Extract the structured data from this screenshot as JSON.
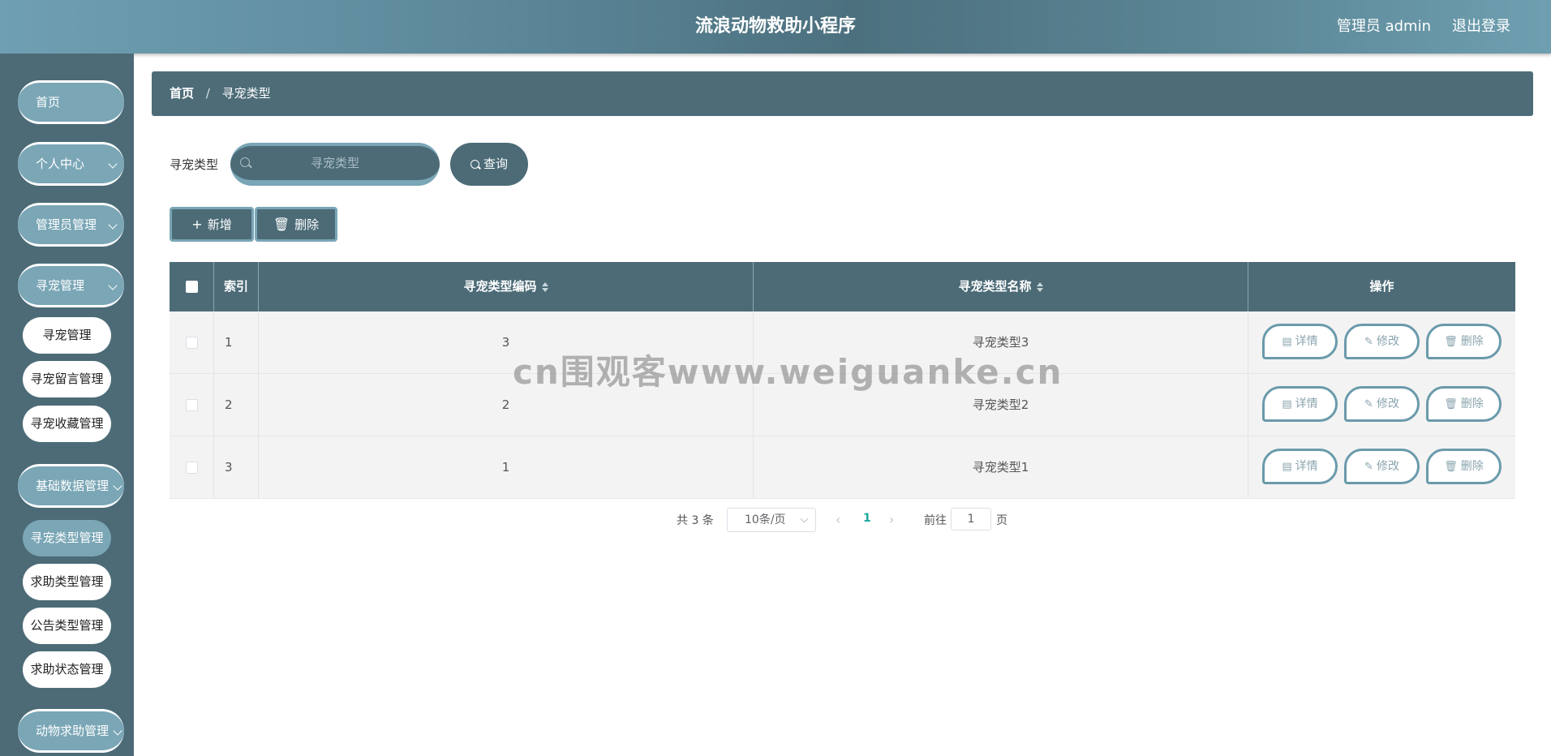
{
  "header": {
    "title": "流浪动物救助小程序",
    "user": "管理员 admin",
    "logout": "退出登录"
  },
  "sidebar": {
    "home": "首页",
    "personal": "个人中心",
    "admin_mgmt": "管理员管理",
    "pet_mgmt": "寻宠管理",
    "pet_sub": [
      "寻宠管理",
      "寻宠留言管理",
      "寻宠收藏管理"
    ],
    "base_data": "基础数据管理",
    "base_sub": [
      "寻宠类型管理",
      "求助类型管理",
      "公告类型管理",
      "求助状态管理"
    ],
    "animal_help": "动物求助管理"
  },
  "breadcrumb": {
    "home": "首页",
    "separator": "/",
    "current": "寻宠类型"
  },
  "search": {
    "label": "寻宠类型",
    "placeholder": "寻宠类型",
    "button": "查询"
  },
  "actions": {
    "add": "新增",
    "delete": "删除"
  },
  "table": {
    "headers": {
      "index": "索引",
      "code": "寻宠类型编码",
      "name": "寻宠类型名称",
      "ops": "操作"
    },
    "rows": [
      {
        "index": "1",
        "code": "3",
        "name": "寻宠类型3"
      },
      {
        "index": "2",
        "code": "2",
        "name": "寻宠类型2"
      },
      {
        "index": "3",
        "code": "1",
        "name": "寻宠类型1"
      }
    ],
    "row_ops": {
      "detail": "详情",
      "edit": "修改",
      "delete": "删除"
    }
  },
  "pagination": {
    "total": "共 3 条",
    "page_size": "10条/页",
    "current_page": "1",
    "goto": "前往",
    "goto_value": "1",
    "unit": "页"
  },
  "watermark": "cn围观客www.weiguanke.cn",
  "colors": {
    "primary": "#4c6b77",
    "accent": "#7aa6b6",
    "page_active": "#1aa99a"
  }
}
